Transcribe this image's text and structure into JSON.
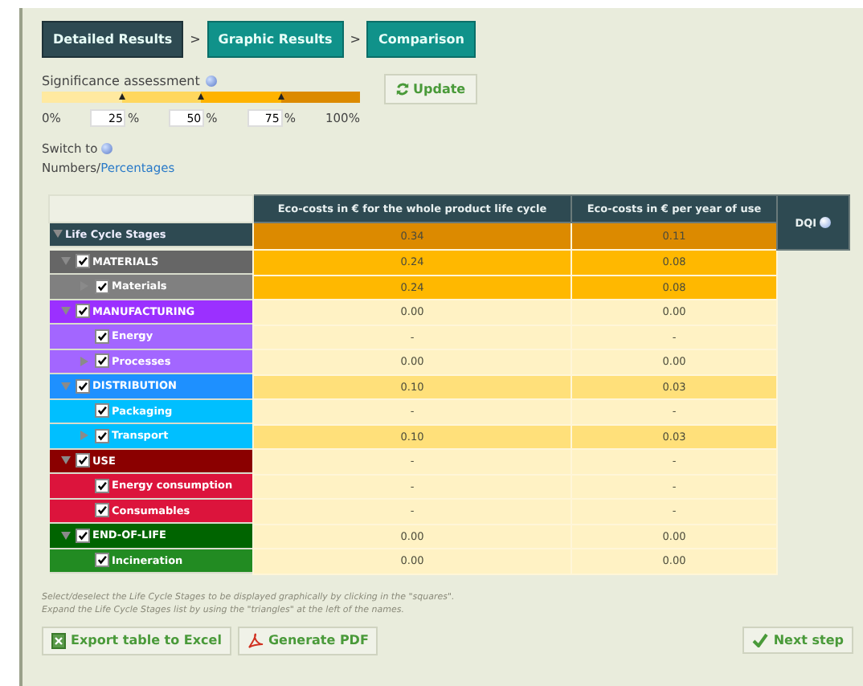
{
  "steps": [
    {
      "label": "Detailed Results",
      "selected": true
    },
    {
      "label": "Graphic Results",
      "selected": false
    },
    {
      "label": "Comparison",
      "selected": false
    }
  ],
  "step_separator": ">",
  "significance": {
    "title": "Significance assessment",
    "bands": [
      {
        "color": "#ffe9a0"
      },
      {
        "color": "#ffd75e"
      },
      {
        "color": "#ffb300"
      },
      {
        "color": "#dc8a00"
      }
    ],
    "start": "0%",
    "end": "100%",
    "thresholds": [
      {
        "value": "25",
        "unit": "%"
      },
      {
        "value": "50",
        "unit": "%"
      },
      {
        "value": "75",
        "unit": "%"
      }
    ],
    "update_button": "Update"
  },
  "switch": {
    "label": "Switch to",
    "options": [
      {
        "label": "Numbers",
        "selected": true
      },
      {
        "label": "Percentages",
        "selected": false
      }
    ],
    "separator": "/"
  },
  "table": {
    "columns": [
      "Eco-costs in € for the whole product life cycle",
      "Eco-costs in € per year of use"
    ],
    "dqi_label": "DQI",
    "rows": [
      {
        "kind": "root",
        "name": "Life Cycle Stages",
        "color": "#2e4a52",
        "expanded": true,
        "checked": null,
        "cells": [
          {
            "value": "0.34",
            "color": "#dc8a00"
          },
          {
            "value": "0.11",
            "color": "#dc8a00"
          }
        ]
      },
      {
        "kind": "group",
        "name": "MATERIALS",
        "color": "#666666",
        "expanded": true,
        "checked": true,
        "cells": [
          {
            "value": "0.24",
            "color": "#ffb800"
          },
          {
            "value": "0.08",
            "color": "#ffb800"
          }
        ]
      },
      {
        "kind": "item",
        "name": "Materials",
        "color": "#808080",
        "expanded": false,
        "checked": true,
        "cells": [
          {
            "value": "0.24",
            "color": "#ffb800"
          },
          {
            "value": "0.08",
            "color": "#ffb800"
          }
        ]
      },
      {
        "kind": "group",
        "name": "MANUFACTURING",
        "color": "#9b30ff",
        "expanded": true,
        "checked": true,
        "cells": [
          {
            "value": "0.00",
            "color": "#fff2c4"
          },
          {
            "value": "0.00",
            "color": "#fff2c4"
          }
        ]
      },
      {
        "kind": "item",
        "name": "Energy",
        "color": "#a366ff",
        "checked": true,
        "cells": [
          {
            "value": "-",
            "color": "#fff2c4"
          },
          {
            "value": "-",
            "color": "#fff2c4"
          }
        ]
      },
      {
        "kind": "item",
        "name": "Processes",
        "color": "#a366ff",
        "expanded": false,
        "checked": true,
        "cells": [
          {
            "value": "0.00",
            "color": "#fff2c4"
          },
          {
            "value": "0.00",
            "color": "#fff2c4"
          }
        ]
      },
      {
        "kind": "group",
        "name": "DISTRIBUTION",
        "color": "#1e90ff",
        "expanded": true,
        "checked": true,
        "cells": [
          {
            "value": "0.10",
            "color": "#ffe07a"
          },
          {
            "value": "0.03",
            "color": "#ffe07a"
          }
        ]
      },
      {
        "kind": "item",
        "name": "Packaging",
        "color": "#00bfff",
        "checked": true,
        "cells": [
          {
            "value": "-",
            "color": "#fff2c4"
          },
          {
            "value": "-",
            "color": "#fff2c4"
          }
        ]
      },
      {
        "kind": "item",
        "name": "Transport",
        "color": "#00bfff",
        "expanded": false,
        "checked": true,
        "cells": [
          {
            "value": "0.10",
            "color": "#ffe07a"
          },
          {
            "value": "0.03",
            "color": "#ffe07a"
          }
        ]
      },
      {
        "kind": "group",
        "name": "USE",
        "color": "#8b0000",
        "expanded": true,
        "checked": true,
        "cells": [
          {
            "value": "-",
            "color": "#fff2c4"
          },
          {
            "value": "-",
            "color": "#fff2c4"
          }
        ]
      },
      {
        "kind": "item",
        "name": "Energy consumption",
        "color": "#dc143c",
        "checked": true,
        "cells": [
          {
            "value": "-",
            "color": "#fff2c4"
          },
          {
            "value": "-",
            "color": "#fff2c4"
          }
        ]
      },
      {
        "kind": "item",
        "name": "Consumables",
        "color": "#dc143c",
        "checked": true,
        "cells": [
          {
            "value": "-",
            "color": "#fff2c4"
          },
          {
            "value": "-",
            "color": "#fff2c4"
          }
        ]
      },
      {
        "kind": "group",
        "name": "END-OF-LIFE",
        "color": "#006400",
        "expanded": true,
        "checked": true,
        "cells": [
          {
            "value": "0.00",
            "color": "#fff2c4"
          },
          {
            "value": "0.00",
            "color": "#fff2c4"
          }
        ]
      },
      {
        "kind": "item",
        "name": "Incineration",
        "color": "#228b22",
        "checked": true,
        "cells": [
          {
            "value": "0.00",
            "color": "#fff2c4"
          },
          {
            "value": "0.00",
            "color": "#fff2c4"
          }
        ]
      }
    ]
  },
  "notes": [
    "Select/deselect the Life Cycle Stages to be displayed graphically by clicking in the \"squares\".",
    "Expand the Life Cycle Stages list by using the \"triangles\" at the left of the names."
  ],
  "buttons": [
    {
      "kind": "excel",
      "label": "Export table to Excel"
    },
    {
      "kind": "pdf",
      "label": "Generate PDF"
    }
  ],
  "next_button": "Next step"
}
